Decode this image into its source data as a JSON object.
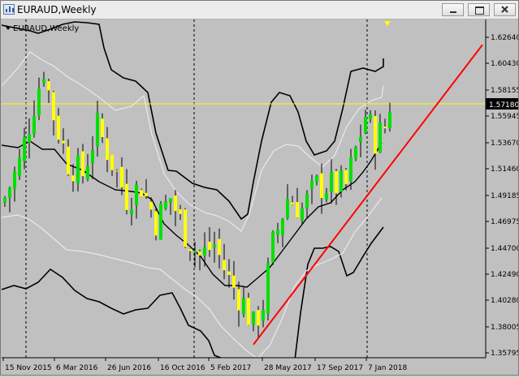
{
  "window": {
    "title": "EURAUD,Weekly",
    "chart_label": "EURAUD,Weekly",
    "current_price": "1.57180"
  },
  "colors": {
    "background": "#c0c0c0",
    "bull_candle": "#00e000",
    "bear_candle": "#ffff00",
    "trendline": "#ff0000",
    "price_line": "#ffff00",
    "outer_bands": "#000000",
    "inner_bands": "#e6e6f0"
  },
  "icons": [
    "chart-icon",
    "minimize-icon",
    "maximize-icon",
    "close-icon",
    "collapse-triangle-icon",
    "shift-marker-icon"
  ],
  "price_scale": [
    "1.62640",
    "1.60430",
    "1.58155",
    "1.55945",
    "1.53670",
    "1.51460",
    "1.49185",
    "1.46975",
    "1.44700",
    "1.42490",
    "1.40280",
    "1.38005",
    "1.35795"
  ],
  "time_scale": [
    "15 Nov 2015",
    "6 Mar 2016",
    "26 Jun 2016",
    "16 Oct 2016",
    "5 Feb 2017",
    "28 May 2017",
    "17 Sep 2017",
    "7 Jan 2018"
  ],
  "chart_data": {
    "type": "candlestick",
    "symbol": "EURAUD",
    "timeframe": "Weekly",
    "ylim": [
      1.35795,
      1.6264
    ],
    "last_price": 1.5718,
    "close_path": [
      [
        0,
        1.49
      ],
      [
        3,
        1.52
      ],
      [
        6,
        1.57
      ],
      [
        8,
        1.6
      ],
      [
        10,
        1.56
      ],
      [
        13,
        1.52
      ],
      [
        16,
        1.51
      ],
      [
        19,
        1.55
      ],
      [
        22,
        1.52
      ],
      [
        25,
        1.49
      ],
      [
        28,
        1.5
      ],
      [
        31,
        1.47
      ],
      [
        34,
        1.49
      ],
      [
        37,
        1.46
      ],
      [
        40,
        1.44
      ],
      [
        43,
        1.45
      ],
      [
        46,
        1.42
      ],
      [
        49,
        1.4
      ],
      [
        51,
        1.38
      ],
      [
        53,
        1.4
      ],
      [
        55,
        1.45
      ],
      [
        58,
        1.49
      ],
      [
        61,
        1.48
      ],
      [
        64,
        1.5
      ],
      [
        67,
        1.5
      ],
      [
        70,
        1.5
      ],
      [
        72,
        1.53
      ],
      [
        74,
        1.56
      ],
      [
        76,
        1.54
      ],
      [
        78,
        1.55
      ],
      [
        79,
        1.57
      ]
    ],
    "trendline": {
      "from": [
        51,
        1.365
      ],
      "to": [
        98,
        1.62
      ]
    }
  }
}
